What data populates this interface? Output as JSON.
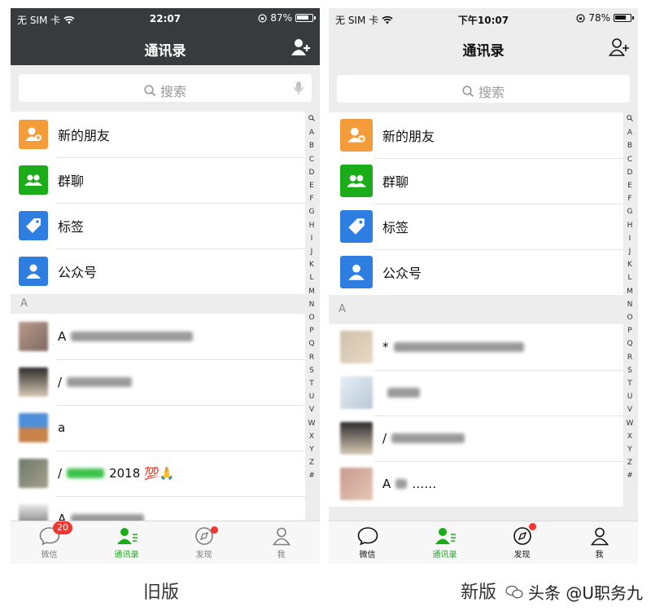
{
  "old": {
    "status": {
      "carrier": "无 SIM 卡",
      "time": "22:07",
      "battery": "87%",
      "battery_level": 0.87
    },
    "title": "通讯录",
    "search_placeholder": "搜索",
    "features": [
      {
        "label": "新的朋友",
        "color": "#f49b3a",
        "icon": "add-friend-icon"
      },
      {
        "label": "群聊",
        "color": "#1aad19",
        "icon": "group-chat-icon"
      },
      {
        "label": "标签",
        "color": "#2e7de0",
        "icon": "tag-icon"
      },
      {
        "label": "公众号",
        "color": "#2e7de0",
        "icon": "official-account-icon"
      }
    ],
    "section": "A",
    "contacts": [
      {
        "prefix": "A",
        "suffix": ""
      },
      {
        "prefix": "/",
        "suffix": ""
      },
      {
        "prefix": "a",
        "suffix": ""
      },
      {
        "prefix": "/",
        "suffix": "2018 💯🙏"
      },
      {
        "prefix": "A",
        "suffix": ""
      }
    ],
    "tabs": [
      {
        "label": "微信",
        "badge": "20"
      },
      {
        "label": "通讯录"
      },
      {
        "label": "发现"
      },
      {
        "label": "我"
      }
    ],
    "caption": "旧版"
  },
  "new": {
    "status": {
      "carrier": "无 SIM 卡",
      "time": "下午10:07",
      "battery": "78%",
      "battery_level": 0.78
    },
    "title": "通讯录",
    "search_placeholder": "搜索",
    "features": [
      {
        "label": "新的朋友",
        "color": "#f49b3a",
        "icon": "add-friend-icon"
      },
      {
        "label": "群聊",
        "color": "#1aad19",
        "icon": "group-chat-icon"
      },
      {
        "label": "标签",
        "color": "#2e7de0",
        "icon": "tag-icon"
      },
      {
        "label": "公众号",
        "color": "#2e7de0",
        "icon": "official-account-icon"
      }
    ],
    "section": "A",
    "contacts": [
      {
        "prefix": "*",
        "suffix": ""
      },
      {
        "prefix": "",
        "suffix": ""
      },
      {
        "prefix": "/",
        "suffix": ""
      },
      {
        "prefix": "A",
        "suffix": "……"
      }
    ],
    "tabs": [
      {
        "label": "微信"
      },
      {
        "label": "通讯录"
      },
      {
        "label": "发现"
      },
      {
        "label": "我"
      }
    ],
    "caption": "新版"
  },
  "index_letters": [
    "A",
    "B",
    "C",
    "D",
    "E",
    "F",
    "G",
    "H",
    "I",
    "J",
    "K",
    "L",
    "M",
    "N",
    "O",
    "P",
    "Q",
    "R",
    "S",
    "T",
    "U",
    "V",
    "W",
    "X",
    "Y",
    "Z",
    "#"
  ],
  "watermark": "头条 @U职务九",
  "accent_green": "#1aad19"
}
